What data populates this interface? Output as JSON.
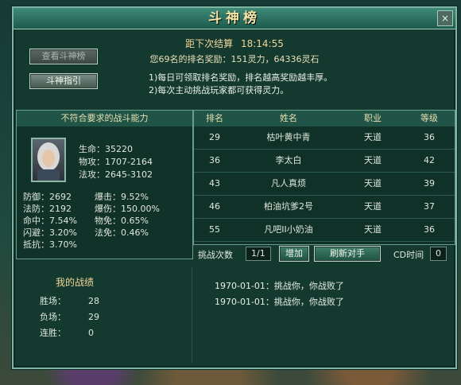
{
  "window": {
    "title": "斗神榜",
    "close_glyph": "×"
  },
  "buttons": {
    "view_rank": "查看斗神榜",
    "guide": "斗神指引",
    "add": "增加",
    "refresh": "刷新对手"
  },
  "countdown": {
    "label": "距下次结算",
    "time": "18:14:55"
  },
  "reward_text": "您69名的排名奖励：151灵力，64336灵石",
  "tips": [
    "1)每日可领取排名奖励，排名越高奖励越丰厚。",
    "2)每次主动挑战玩家都可获得灵力。"
  ],
  "left_panel": {
    "header": "不符合要求的战斗能力",
    "main_stats": [
      {
        "label": "生命：",
        "value": "35220"
      },
      {
        "label": "物攻：",
        "value": "1707-2164"
      },
      {
        "label": "法攻：",
        "value": "2645-3102"
      }
    ],
    "stats_left": [
      {
        "label": "防御：",
        "value": "2692"
      },
      {
        "label": "法防：",
        "value": "2192"
      },
      {
        "label": "命中：",
        "value": "7.54%"
      },
      {
        "label": "闪避：",
        "value": "3.20%"
      },
      {
        "label": "抵抗：",
        "value": "3.70%"
      }
    ],
    "stats_right": [
      {
        "label": "爆击：",
        "value": "9.52%"
      },
      {
        "label": "爆伤：",
        "value": "150.00%"
      },
      {
        "label": "物免：",
        "value": "0.65%"
      },
      {
        "label": "法免：",
        "value": "0.46%"
      }
    ]
  },
  "ranking": {
    "headers": [
      "排名",
      "姓名",
      "职业",
      "等级"
    ],
    "rows": [
      [
        "29",
        "枯叶黄中青",
        "天道",
        "36"
      ],
      [
        "36",
        "李太白",
        "天道",
        "42"
      ],
      [
        "43",
        "凡人真烦",
        "天道",
        "39"
      ],
      [
        "46",
        "柏油坑爹2号",
        "天道",
        "37"
      ],
      [
        "55",
        "凡吧II小奶油",
        "天道",
        "36"
      ]
    ]
  },
  "challenge": {
    "label": "挑战次数",
    "count": "1/1",
    "cd_label": "CD时间",
    "cd_value": "0"
  },
  "record": {
    "title": "我的战绩",
    "wins_label": "胜场：",
    "wins": "28",
    "losses_label": "负场：",
    "losses": "29",
    "streak_label": "连胜：",
    "streak": "0"
  },
  "battle_log": [
    "1970-01-01：挑战你，你战败了",
    "1970-01-01：挑战你，你战败了"
  ]
}
